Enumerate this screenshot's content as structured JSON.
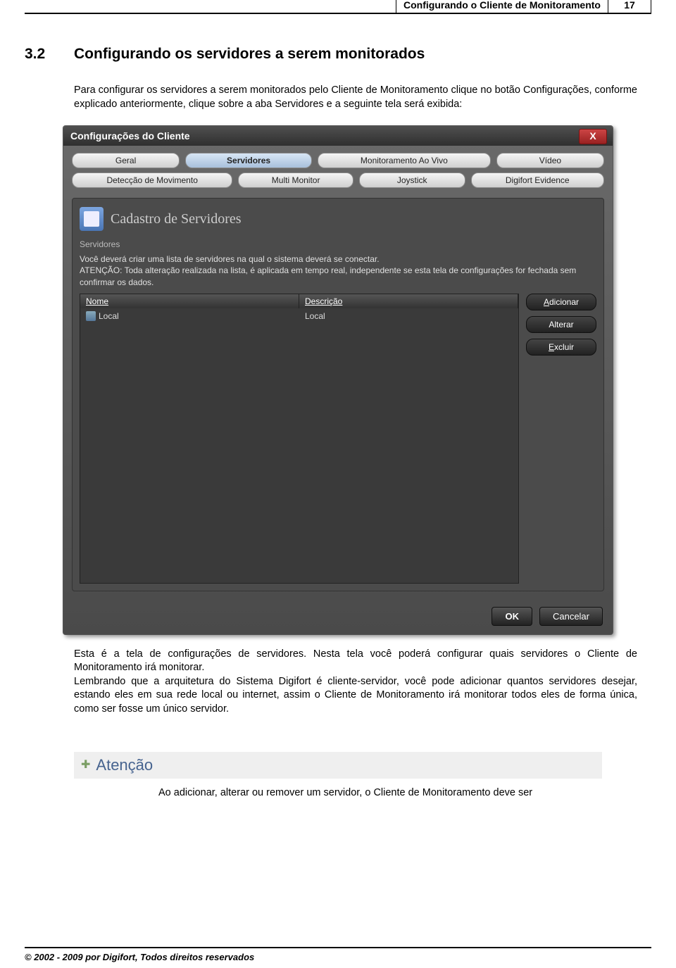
{
  "header": {
    "title": "Configurando o Cliente de Monitoramento",
    "page_number": "17"
  },
  "section": {
    "number": "3.2",
    "title": "Configurando os servidores a serem monitorados"
  },
  "paragraphs": {
    "intro": "Para configurar os servidores a serem monitorados pelo Cliente de Monitoramento clique no botão Configurações, conforme explicado anteriormente, clique sobre a aba Servidores e a seguinte tela será exibida:",
    "after1": "Esta é a tela de configurações de servidores. Nesta tela você poderá configurar quais servidores o Cliente de Monitoramento irá monitorar.",
    "after2": "Lembrando que a arquitetura do Sistema Digifort é cliente-servidor, você pode adicionar quantos servidores desejar, estando eles em sua rede local ou internet, assim o Cliente de Monitoramento irá monitorar todos eles de forma única, como ser fosse um único servidor."
  },
  "window": {
    "title": "Configurações do Cliente",
    "tabs_row1": [
      "Geral",
      "Servidores",
      "Monitoramento Ao Vivo",
      "Vídeo"
    ],
    "tabs_row2": [
      "Detecção de Movimento",
      "Multi Monitor",
      "Joystick",
      "Digifort Evidence"
    ],
    "active_tab": "Servidores",
    "panel_title": "Cadastro de Servidores",
    "group_label": "Servidores",
    "instructions_line1": "Você deverá criar uma lista de servidores na qual o sistema deverá se conectar.",
    "instructions_line2": "ATENÇÃO: Toda alteração realizada na lista, é aplicada em tempo real, independente se esta tela de configurações for fechada sem confirmar os dados.",
    "table": {
      "columns": [
        "Nome",
        "Descrição"
      ],
      "rows": [
        {
          "name": "Local",
          "desc": "Local"
        }
      ]
    },
    "side_buttons": {
      "add": "Adicionar",
      "edit": "Alterar",
      "delete": "Excluir"
    },
    "bottom_buttons": {
      "ok": "OK",
      "cancel": "Cancelar"
    },
    "close_glyph": "X"
  },
  "attention": {
    "label": "Atenção",
    "body": "Ao adicionar, alterar ou remover um servidor, o Cliente de Monitoramento deve ser"
  },
  "footer": {
    "copyright": "© 2002 - 2009  por Digifort, Todos direitos reservados"
  }
}
